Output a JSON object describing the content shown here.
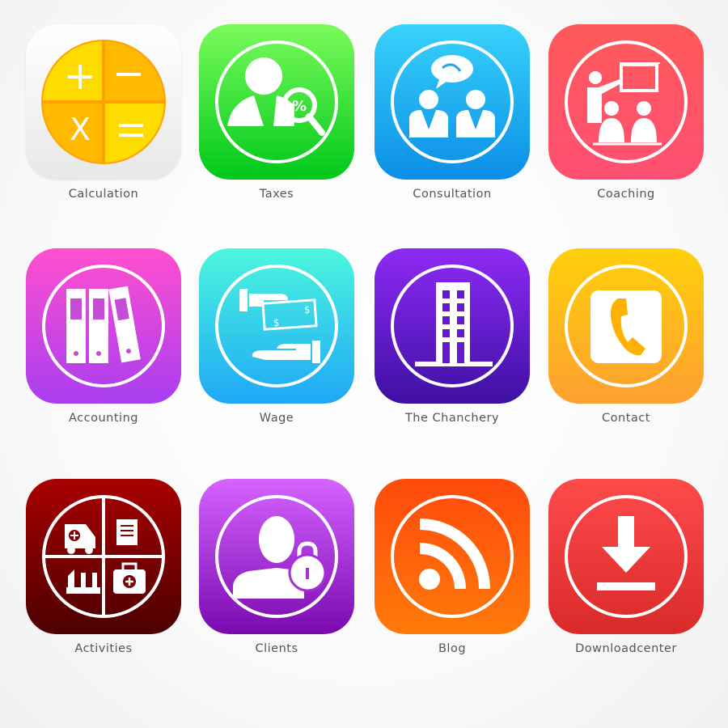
{
  "apps": [
    {
      "label": "Calculation",
      "icon": "calculator-icon",
      "colors": [
        "#ffffff",
        "#e8e8e8"
      ]
    },
    {
      "label": "Taxes",
      "icon": "tax-search-icon",
      "colors": [
        "#7bfb5c",
        "#00c81a"
      ]
    },
    {
      "label": "Consultation",
      "icon": "consultation-icon",
      "colors": [
        "#38d2fb",
        "#0b8ee6"
      ]
    },
    {
      "label": "Coaching",
      "icon": "coaching-icon",
      "colors": [
        "#ff5a5a",
        "#ff4f72"
      ]
    },
    {
      "label": "Accounting",
      "icon": "binders-icon",
      "colors": [
        "#ff4fcf",
        "#a83ef0"
      ]
    },
    {
      "label": "Wage",
      "icon": "money-hands-icon",
      "colors": [
        "#4cf6dd",
        "#1ea8f7"
      ]
    },
    {
      "label": "The Chanchery",
      "icon": "building-icon",
      "colors": [
        "#8d2af5",
        "#3e10a3"
      ]
    },
    {
      "label": "Contact",
      "icon": "phone-icon",
      "colors": [
        "#ffd00a",
        "#fda030"
      ]
    },
    {
      "label": "Activities",
      "icon": "activities-icon",
      "colors": [
        "#a80000",
        "#4c0000"
      ]
    },
    {
      "label": "Clients",
      "icon": "user-lock-icon",
      "colors": [
        "#d563ff",
        "#7a0ab0"
      ]
    },
    {
      "label": "Blog",
      "icon": "rss-icon",
      "colors": [
        "#ff4a0c",
        "#ff7a0a"
      ]
    },
    {
      "label": "Downloadcenter",
      "icon": "download-icon",
      "colors": [
        "#ff4a4a",
        "#d92a2a"
      ]
    }
  ]
}
